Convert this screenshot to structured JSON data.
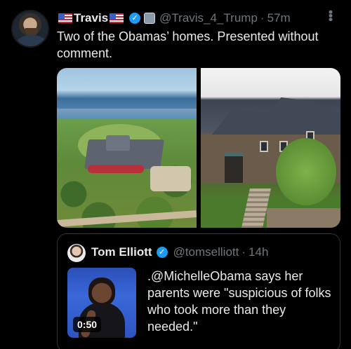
{
  "tweet": {
    "author": {
      "display_name": "Travis",
      "handle": "@Travis_4_Trump",
      "time": "57m",
      "verified": true
    },
    "separator": "·",
    "text": "Two of the Obamas’ homes. Presented without comment.",
    "menu_icon": "more-options-icon",
    "media": [
      {
        "icon": "aerial-estate-photo"
      },
      {
        "icon": "stone-house-photo"
      }
    ]
  },
  "quoted_tweet": {
    "author": {
      "display_name": "Tom Elliott",
      "handle": "@tomselliott",
      "time": "14h",
      "verified": true
    },
    "separator": "·",
    "video_duration": "0:50",
    "text": ".@MichelleObama says her parents were \"suspicious of folks who took more than they needed.\""
  },
  "colors": {
    "background": "#000000",
    "text": "#e7e9ea",
    "muted": "#71767b",
    "verified": "#1d9bf0",
    "border": "#2f3336"
  }
}
